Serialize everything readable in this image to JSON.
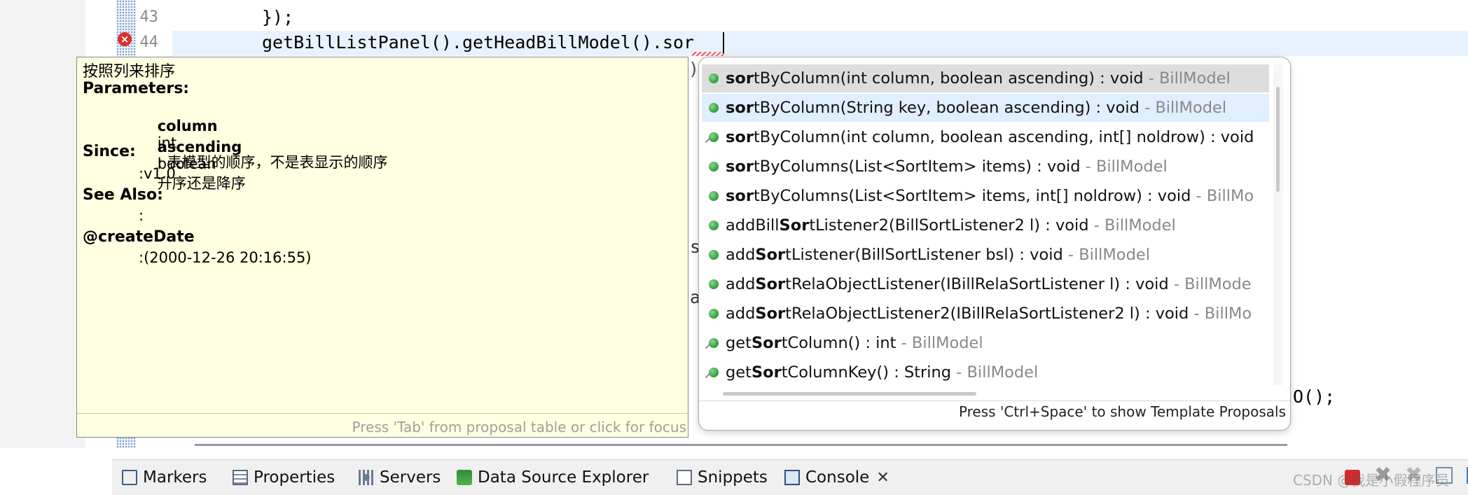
{
  "editor": {
    "line_numbers": [
      "43",
      "44"
    ],
    "lines": {
      "l43": "});",
      "l44": "getBillListPanel().getHeadBillModel().sor"
    },
    "fragments": {
      "paren": ")",
      "s": "s",
      "a": "a",
      "paren_semicolon": "O();"
    },
    "colors": {
      "error": "#d9322c",
      "current_line": "#e8f2fe"
    }
  },
  "javadoc": {
    "summary": "按照列来排序",
    "parameters_heading": "Parameters:",
    "params": [
      {
        "name": "column",
        "type": "int",
        "desc": ": 表模型的顺序，不是表显示的顺序"
      },
      {
        "name": "ascending",
        "type": "boolean",
        "desc": "升序还是降序"
      }
    ],
    "since_heading": "Since:",
    "since_value": ":v1.0",
    "see_also_heading": "See Also:",
    "see_also_value": ":",
    "create_date_heading": "@createDate",
    "create_date_value": ":(2000-12-26 20:16:55)",
    "hint": "Press 'Tab' from proposal table or click for focus"
  },
  "proposals": {
    "items": [
      {
        "pre": "",
        "bold": "sor",
        "rest": "tByColumn(int column, boolean ascending) : void",
        "owner": " - BillModel",
        "icon": "public-method-icon"
      },
      {
        "pre": "",
        "bold": "sor",
        "rest": "tByColumn(String key, boolean ascending) : void",
        "owner": " - BillModel",
        "icon": "public-method-icon"
      },
      {
        "pre": "",
        "bold": "sor",
        "rest": "tByColumn(int column, boolean ascending, int[] noldrow) : void",
        "owner": "",
        "icon": "deprecated-method-icon"
      },
      {
        "pre": "",
        "bold": "sor",
        "rest": "tByColumns(List<SortItem> items) : void",
        "owner": " - BillModel",
        "icon": "public-method-icon"
      },
      {
        "pre": "",
        "bold": "sor",
        "rest": "tByColumns(List<SortItem> items, int[] noldrow) : void",
        "owner": " - BillMo",
        "icon": "public-method-icon"
      },
      {
        "pre": "addBill",
        "bold": "Sor",
        "rest": "tListener2(BillSortListener2 l) : void",
        "owner": " - BillModel",
        "icon": "public-method-icon"
      },
      {
        "pre": "add",
        "bold": "Sor",
        "rest": "tListener(BillSortListener bsl) : void",
        "owner": " - BillModel",
        "icon": "public-method-icon"
      },
      {
        "pre": "add",
        "bold": "Sor",
        "rest": "tRelaObjectListener(IBillRelaSortListener l) : void",
        "owner": " - BillMode",
        "icon": "public-method-icon"
      },
      {
        "pre": "add",
        "bold": "Sor",
        "rest": "tRelaObjectListener2(IBillRelaSortListener2 l) : void",
        "owner": " - BillMo",
        "icon": "public-method-icon"
      },
      {
        "pre": "get",
        "bold": "Sor",
        "rest": "tColumn() : int",
        "owner": " - BillModel",
        "icon": "deprecated-method-icon"
      },
      {
        "pre": "get",
        "bold": "Sor",
        "rest": "tColumnKey() : String",
        "owner": " - BillModel",
        "icon": "deprecated-method-icon"
      }
    ],
    "hint": "Press 'Ctrl+Space' to show Template Proposals"
  },
  "bottom_tabs": {
    "markers": "Markers",
    "properties": "Properties",
    "servers": "Servers",
    "data_source_explorer": "Data Source Explorer",
    "snippets": "Snippets",
    "console": "Console",
    "close_glyph": "✕"
  },
  "toolbar": {
    "remove_glyph": "✖",
    "remove_all_glyph": "✖"
  },
  "watermark": "CSDN @我是小假程序员"
}
